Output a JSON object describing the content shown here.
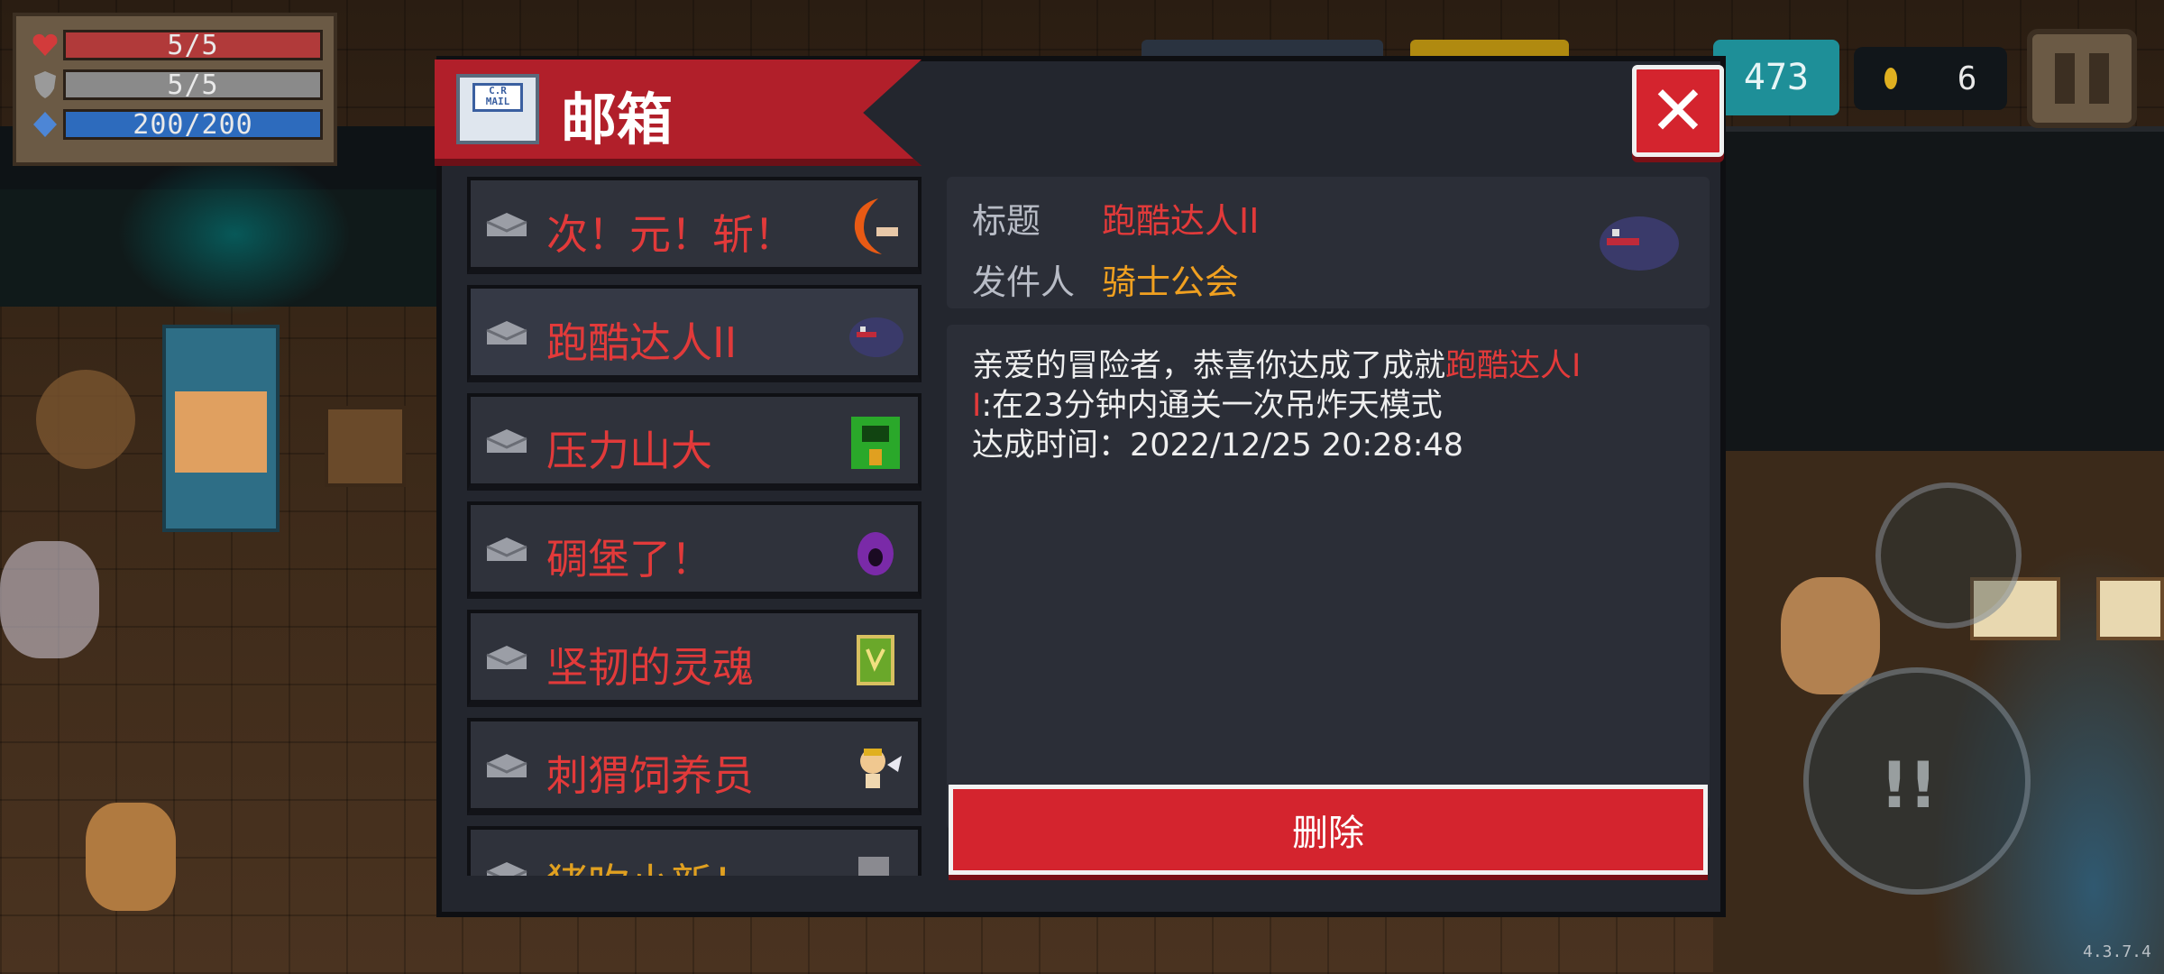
{
  "hud": {
    "hp": "5/5",
    "armor": "5/5",
    "energy": "200/200",
    "currency": "473",
    "coins": "6",
    "version": "4.3.7.4"
  },
  "mailbox": {
    "title": "邮箱",
    "envelope_tag": "C.R MAIL",
    "mails": [
      {
        "label": "次！元！斩！",
        "icon": "crescent-blade-icon"
      },
      {
        "label": "跑酷达人II",
        "icon": "shadow-beast-icon"
      },
      {
        "label": "压力山大",
        "icon": "green-boss-icon"
      },
      {
        "label": "碉堡了！",
        "icon": "purple-creature-icon"
      },
      {
        "label": "坚韧的灵魂",
        "icon": "green-book-icon"
      },
      {
        "label": "刺猬饲养员",
        "icon": "cupid-icon"
      },
      {
        "label": "猪吹小新！",
        "icon": "gray-cat-icon"
      }
    ],
    "detail": {
      "title_label": "标题",
      "title_value": "跑酷达人II",
      "sender_label": "发件人",
      "sender_value": "骑士公会",
      "body_prefix": "亲爱的冒险者，恭喜你达成了成就",
      "body_highlight_a": "跑酷达人I",
      "body_highlight_b": "I",
      "body_line2_rest": ":在23分钟内通关一次吊炸天模式",
      "body_line3": "达成时间：2022/12/25 20:28:48"
    },
    "delete_label": "删除"
  },
  "colors": {
    "accent_red": "#d4242e",
    "mail_red_text": "#e23a3a",
    "sender_gold": "#f0a020",
    "panel_bg": "#23262e"
  }
}
